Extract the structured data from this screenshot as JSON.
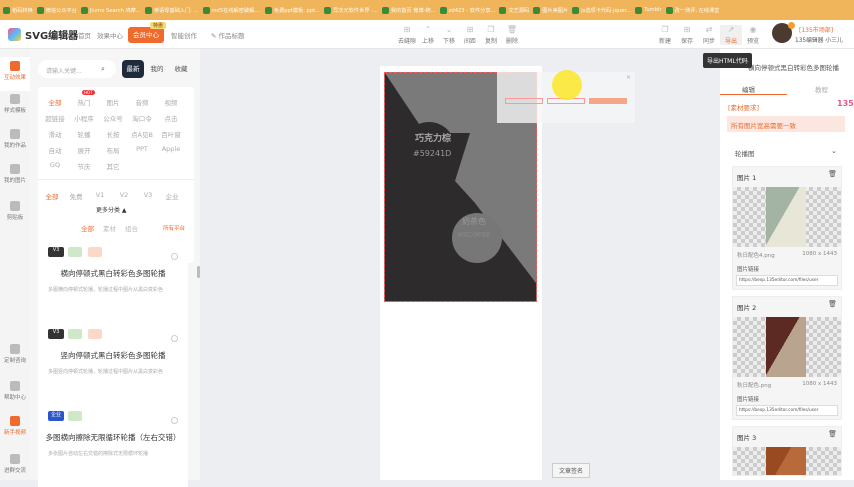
{
  "bookmarks": [
    "稻码转换",
    "微信公众平台",
    "Jiumo Search 鸠摩...",
    "英语零基础入门: ...",
    "md5在线解密破解,...",
    "免费ppt模板, ppt...",
    "异次元软件世界 -...",
    "我的首页 微博-随...",
    "zd423 - 软件分享...",
    "文艺源码",
    "图片美图片",
    "js选项卡代码-jquer...",
    "Tumblr",
    "孜一测评, 在线课堂"
  ],
  "header": {
    "app": "SVG编辑器",
    "nav": [
      "首页",
      "效果中心"
    ],
    "vip": "会员中心",
    "vip_badge": "特惠",
    "smart": "智能创作",
    "title": "作品标题",
    "tools": [
      "去缝隙",
      "上移",
      "下移",
      "间距",
      "复制",
      "删除"
    ],
    "tools_right": [
      "新建",
      "保存",
      "同步",
      "导出",
      "预览"
    ],
    "user_tag": "[135市场部]",
    "user_name": "135编辑器 小三儿"
  },
  "sidebar": [
    "互动效果",
    "样式模板",
    "我的作品",
    "我的图片",
    "剪贴板",
    "定制咨询",
    "帮助中心",
    "新手视频",
    "进群交流"
  ],
  "left": {
    "search_placeholder": "请输入关键...",
    "tabs": [
      "最新",
      "我的",
      "收藏"
    ],
    "hot": "HOT",
    "cats": [
      "全部",
      "热门",
      "图片",
      "音频",
      "视频",
      "超链接",
      "小程序",
      "公众号",
      "淘口令",
      "点击",
      "滑动",
      "轮播",
      "长按",
      "点A见B",
      "百叶窗",
      "自动",
      "展开",
      "布局",
      "PPT",
      "Apple",
      "GQ",
      "节庆",
      "其它"
    ],
    "levels": [
      "全部",
      "免费",
      "V1",
      "V2",
      "V3",
      "企业"
    ],
    "more": "更多分类 ▲",
    "filters": [
      "全部",
      "素材",
      "组合"
    ],
    "platform": "所有平台",
    "cards": [
      {
        "badge": "V3",
        "title": "横向停顿式黑白转彩色多图轮播",
        "desc": "多图横向停顿式轮播，轮播过程中图片从黑白变彩色"
      },
      {
        "badge": "V3",
        "title": "竖向停顿式黑白转彩色多图轮播",
        "desc": "多图竖向停顿式轮播，轮播过程中图片从黑白变彩色"
      },
      {
        "badge": "企业",
        "title": "多图横向擦除无限循环轮播（左右交错）",
        "desc": "多张图片自动左右交错的擦除式无限循环轮播"
      }
    ]
  },
  "canvas": {
    "t1": "巧克力棕",
    "c1": "#59241D",
    "t2": "奶茶色",
    "c2": "#BD9F8E",
    "sign": "文章签名"
  },
  "right": {
    "tooltip": "导出HTML代码",
    "title": "横向停顿式黑白转彩色多图轮播",
    "tabs": [
      "编辑",
      "教程"
    ],
    "req": "[素材要求]",
    "note": "所有图片宽高需要一致",
    "section": "轮播图",
    "pics": [
      {
        "label": "图片 1",
        "file": "秋日配色4.png",
        "size": "1080 x 1443",
        "link_label": "图片链接",
        "url": "https://bexp.135editor.com/files/user"
      },
      {
        "label": "图片 2",
        "file": "秋日配色.png",
        "size": "1080 x 1443",
        "link_label": "图片链接",
        "url": "https://bexp.135editor.com/files/user"
      },
      {
        "label": "图片 3"
      }
    ]
  }
}
